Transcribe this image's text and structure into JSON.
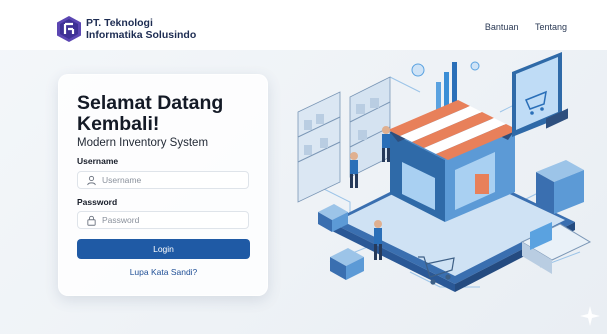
{
  "header": {
    "brand_line1": "PT. Teknologi",
    "brand_line2": "Informatika Solusindo",
    "nav": [
      "Bantuan",
      "Tentang"
    ]
  },
  "login": {
    "title": "Selamat Datang Kembali!",
    "subtitle": "Modern Inventory System",
    "username_label": "Username",
    "username_placeholder": "Username",
    "password_label": "Password",
    "password_placeholder": "Password",
    "login_button": "Login",
    "forgot_link": "Lupa Kata Sandi?"
  },
  "icons": [
    "app-logo-icon",
    "user-icon",
    "lock-icon",
    "sparkle-icon"
  ],
  "colors": {
    "brand_blue": "#1f5aa5",
    "link_blue": "#1f4f96",
    "heading": "#141a26",
    "illustration_blue": "#3a8ed6"
  }
}
